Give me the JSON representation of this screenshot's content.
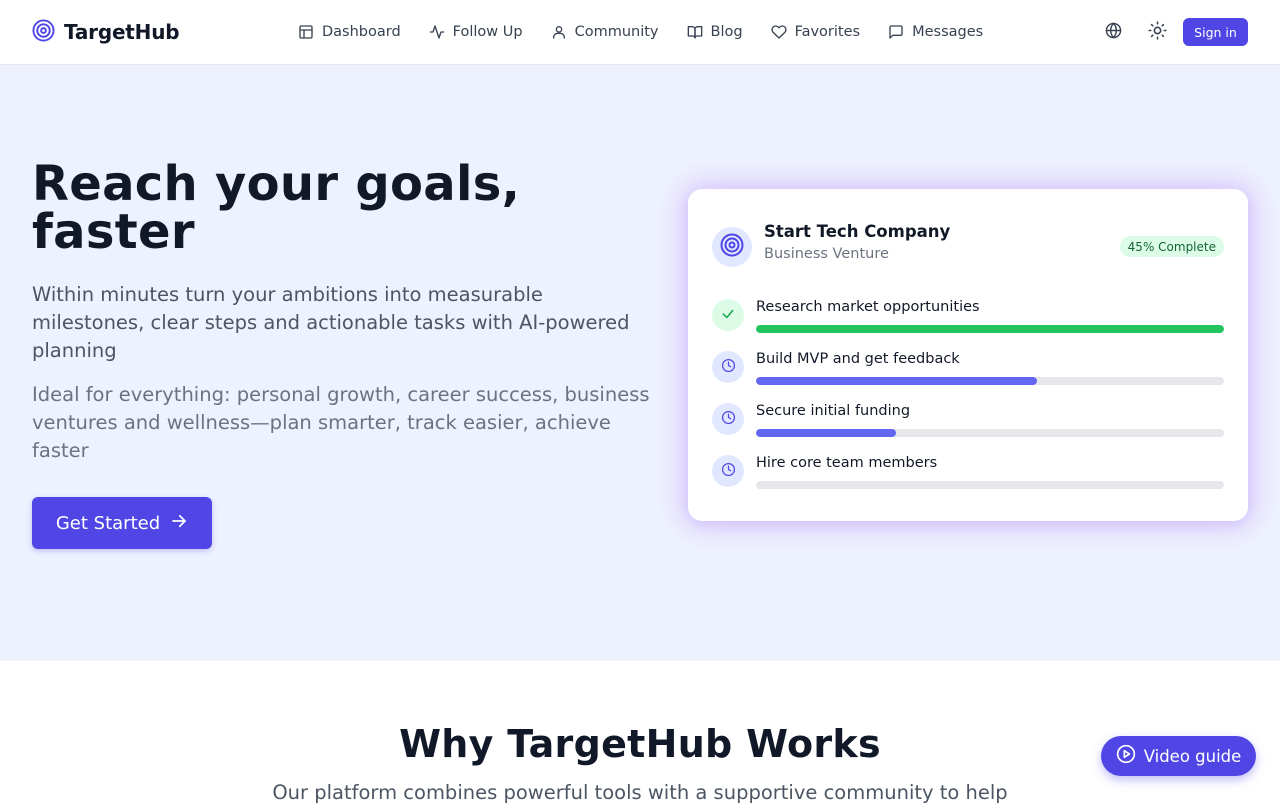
{
  "brand": {
    "name": "TargetHub",
    "icon": "target-icon",
    "accent": "#4f46e5"
  },
  "nav": {
    "items": [
      {
        "label": "Dashboard",
        "icon": "dashboard-icon"
      },
      {
        "label": "Follow Up",
        "icon": "activity-icon"
      },
      {
        "label": "Community",
        "icon": "user-icon"
      },
      {
        "label": "Blog",
        "icon": "book-icon"
      },
      {
        "label": "Favorites",
        "icon": "heart-icon"
      },
      {
        "label": "Messages",
        "icon": "message-icon"
      }
    ]
  },
  "header_actions": {
    "language_icon": "globe-icon",
    "theme_icon": "sun-icon",
    "signin_label": "Sign in"
  },
  "hero": {
    "title": "Reach your goals, faster",
    "subtitle": "Within minutes turn your ambitions into measurable milestones, clear steps and actionable tasks with AI-powered planning",
    "subtitle2": "Ideal for everything: personal growth, career success, business ventures and wellness—plan smarter, track easier, achieve faster",
    "cta_label": "Get Started",
    "cta_icon": "arrow-right-icon"
  },
  "goal_card": {
    "title": "Start Tech Company",
    "category": "Business Venture",
    "badge": "45% Complete",
    "tasks": [
      {
        "label": "Research market opportunities",
        "status": "done",
        "icon": "check-icon",
        "progress": 1.0,
        "color": "#22c55e"
      },
      {
        "label": "Build MVP and get feedback",
        "status": "in-progress",
        "icon": "clock-icon",
        "progress": 0.6,
        "color": "#6366f1"
      },
      {
        "label": "Secure initial funding",
        "status": "in-progress",
        "icon": "clock-icon",
        "progress": 0.3,
        "color": "#6366f1"
      },
      {
        "label": "Hire core team members",
        "status": "pending",
        "icon": "clock-icon",
        "progress": 0.0,
        "color": "#6366f1"
      }
    ]
  },
  "why": {
    "title": "Why TargetHub Works",
    "subtitle": "Our platform combines powerful tools with a supportive community to help"
  },
  "video_guide": {
    "label": "Video guide",
    "icon": "play-circle-icon"
  }
}
